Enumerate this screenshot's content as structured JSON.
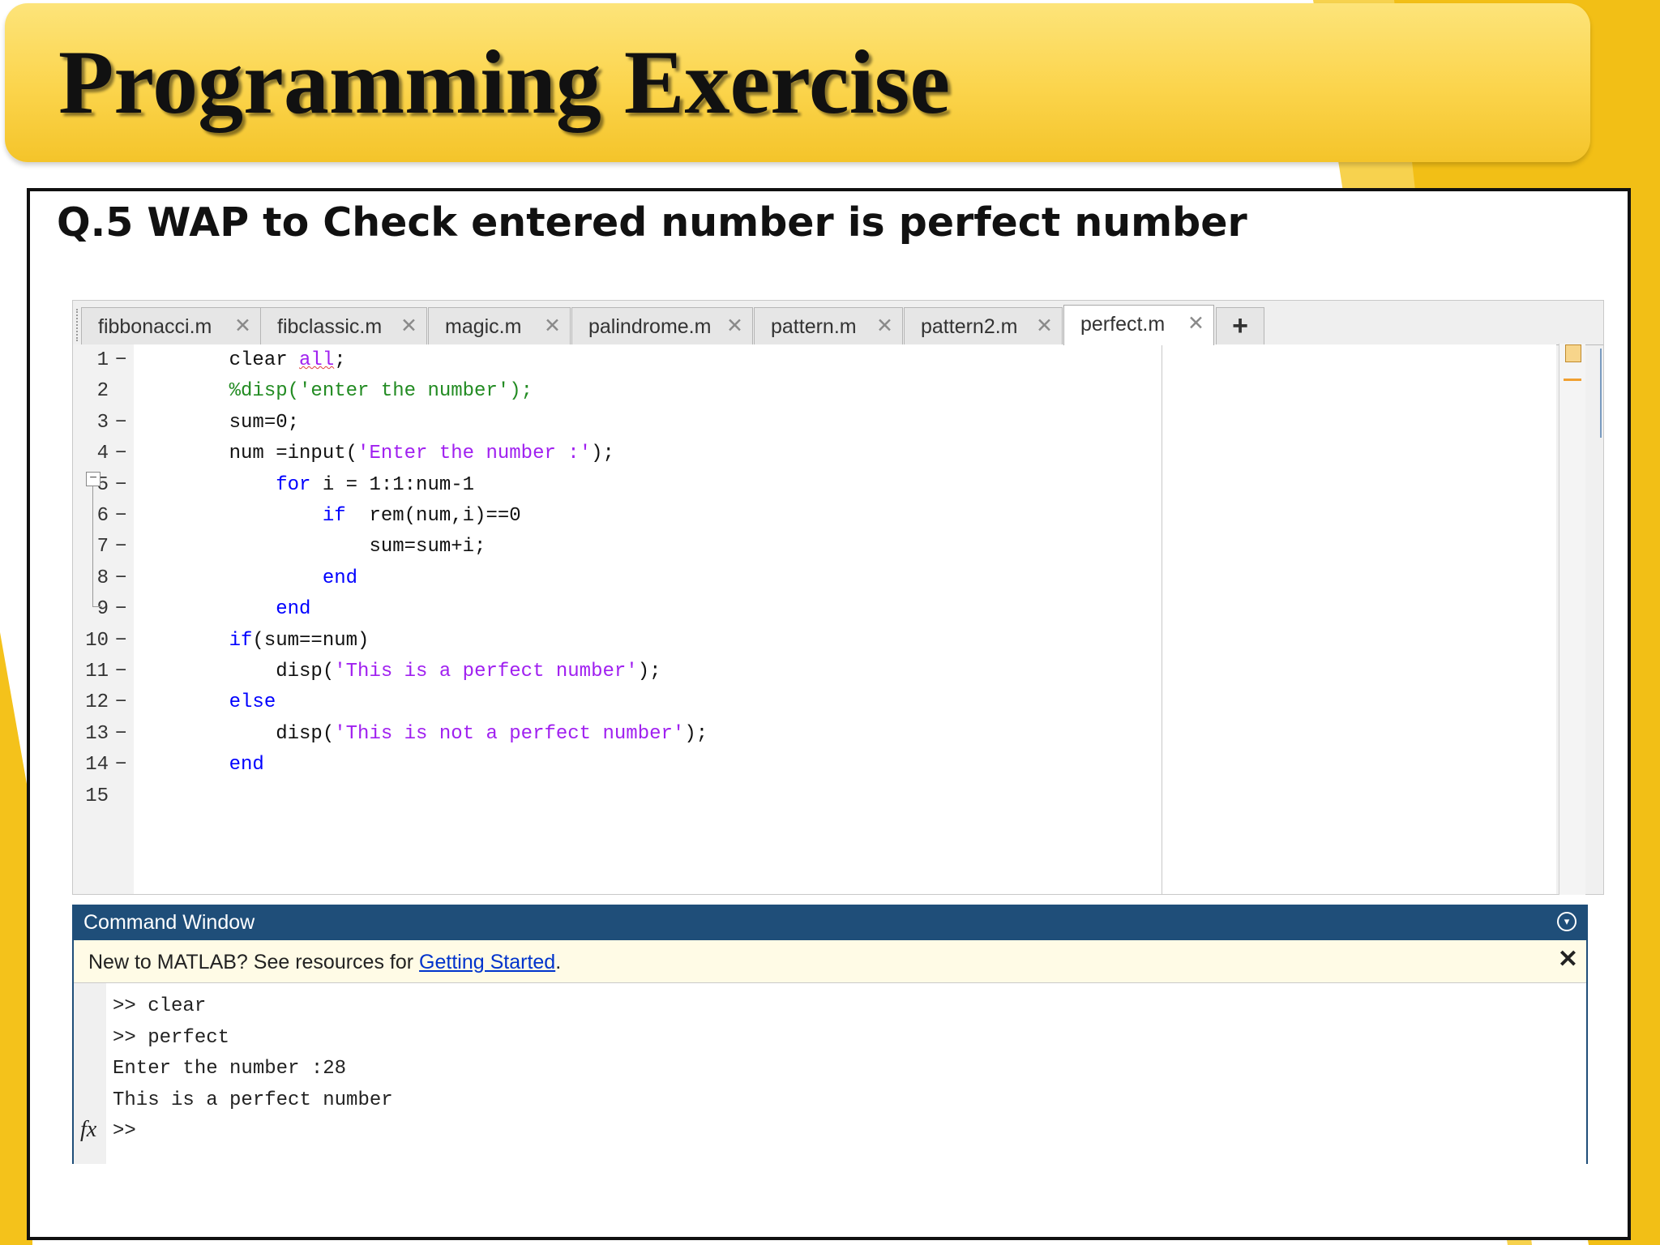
{
  "slide": {
    "title": "Programming Exercise",
    "question": "Q.5  WAP to Check entered number is perfect number"
  },
  "colors": {
    "banner": "#fbd44b",
    "accent_yellow": "#f4c21b",
    "cmd_header": "#1f4e79"
  },
  "editor": {
    "tabs": [
      {
        "label": "fibbonacci.m",
        "close": "✕"
      },
      {
        "label": "fibclassic.m",
        "close": "✕"
      },
      {
        "label": "magic.m",
        "close": "✕"
      },
      {
        "label": "palindrome.m",
        "close": "✕"
      },
      {
        "label": "pattern.m",
        "close": "✕"
      },
      {
        "label": "pattern2.m",
        "close": "✕"
      },
      {
        "label": "perfect.m",
        "close": "✕",
        "active": true
      }
    ],
    "add_tab": "+",
    "dash": "−",
    "fold": "−",
    "lines": [
      {
        "n": "1",
        "segs": [
          {
            "t": "    clear ",
            "c": ""
          },
          {
            "t": "all",
            "c": "str squig"
          },
          {
            "t": ";",
            "c": ""
          }
        ]
      },
      {
        "n": "2",
        "segs": [
          {
            "t": "    %disp('enter the number');",
            "c": "cmt"
          }
        ]
      },
      {
        "n": "3",
        "segs": [
          {
            "t": "    sum=0;",
            "c": ""
          }
        ]
      },
      {
        "n": "4",
        "segs": [
          {
            "t": "    num =input(",
            "c": ""
          },
          {
            "t": "'Enter the number :'",
            "c": "str"
          },
          {
            "t": ");",
            "c": ""
          }
        ]
      },
      {
        "n": "5",
        "segs": [
          {
            "t": "        ",
            "c": ""
          },
          {
            "t": "for",
            "c": "kw"
          },
          {
            "t": " i = 1:1:num-1",
            "c": ""
          }
        ]
      },
      {
        "n": "6",
        "segs": [
          {
            "t": "            ",
            "c": ""
          },
          {
            "t": "if",
            "c": "kw"
          },
          {
            "t": "  rem(num,i)==0",
            "c": ""
          }
        ]
      },
      {
        "n": "7",
        "segs": [
          {
            "t": "                sum=sum+i;",
            "c": ""
          }
        ]
      },
      {
        "n": "8",
        "segs": [
          {
            "t": "            ",
            "c": ""
          },
          {
            "t": "end",
            "c": "kw"
          }
        ]
      },
      {
        "n": "9",
        "segs": [
          {
            "t": "        ",
            "c": ""
          },
          {
            "t": "end",
            "c": "kw"
          }
        ]
      },
      {
        "n": "10",
        "segs": [
          {
            "t": "    ",
            "c": ""
          },
          {
            "t": "if",
            "c": "kw"
          },
          {
            "t": "(sum==num)",
            "c": ""
          }
        ]
      },
      {
        "n": "11",
        "segs": [
          {
            "t": "        disp(",
            "c": ""
          },
          {
            "t": "'This is a perfect number'",
            "c": "str"
          },
          {
            "t": ");",
            "c": ""
          }
        ]
      },
      {
        "n": "12",
        "segs": [
          {
            "t": "    ",
            "c": ""
          },
          {
            "t": "else",
            "c": "kw"
          }
        ]
      },
      {
        "n": "13",
        "segs": [
          {
            "t": "        disp(",
            "c": ""
          },
          {
            "t": "'This is not a perfect number'",
            "c": "str"
          },
          {
            "t": ");",
            "c": ""
          }
        ]
      },
      {
        "n": "14",
        "segs": [
          {
            "t": "    ",
            "c": ""
          },
          {
            "t": "end",
            "c": "kw"
          }
        ]
      },
      {
        "n": "15",
        "segs": []
      }
    ],
    "dash_lines": [
      "1",
      "3",
      "4",
      "5",
      "6",
      "7",
      "8",
      "9",
      "10",
      "11",
      "12",
      "13",
      "14"
    ]
  },
  "command_window": {
    "title": "Command Window",
    "menu_icon": "▾",
    "notice_prefix": "New to MATLAB? See resources for ",
    "notice_link": "Getting Started",
    "notice_suffix": ".",
    "notice_close": "✕",
    "fx": "fx",
    "lines": [
      ">> clear",
      ">> perfect",
      "Enter the number :28",
      "This is a perfect number",
      ">>"
    ]
  }
}
